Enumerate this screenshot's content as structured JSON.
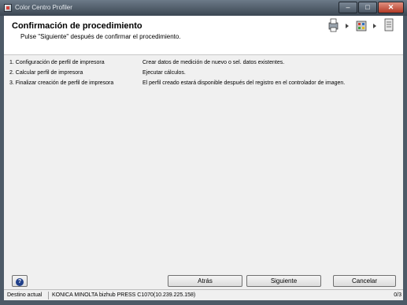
{
  "window": {
    "title": "Color Centro Profiler",
    "minimize_label": "–",
    "maximize_label": "□",
    "close_label": "✕"
  },
  "header": {
    "title": "Confirmación de procedimiento",
    "subtitle": "Pulse \"Siguiente\" después de confirmar el procedimiento.",
    "step_icons": [
      "printer-step-icon",
      "calculate-step-icon",
      "finish-step-icon"
    ]
  },
  "procedure": [
    {
      "step": "1. Configuración de perfil de impresora",
      "description": "Crear datos de medición de nuevo o sel. datos existentes."
    },
    {
      "step": "2. Calcular perfil de impresora",
      "description": "Ejecutar cálculos."
    },
    {
      "step": "3. Finalizar creación de perfil de impresora",
      "description": "El perfil creado estará disponible después del registro en el controlador de imagen."
    }
  ],
  "buttons": {
    "help": "?",
    "back": "Atrás",
    "next": "Siguiente",
    "cancel": "Cancelar"
  },
  "status": {
    "label": "Destino actual",
    "printer": "KONICA MINOLTA bizhub PRESS C1070(10.239.225.158)",
    "page": "0/3"
  }
}
